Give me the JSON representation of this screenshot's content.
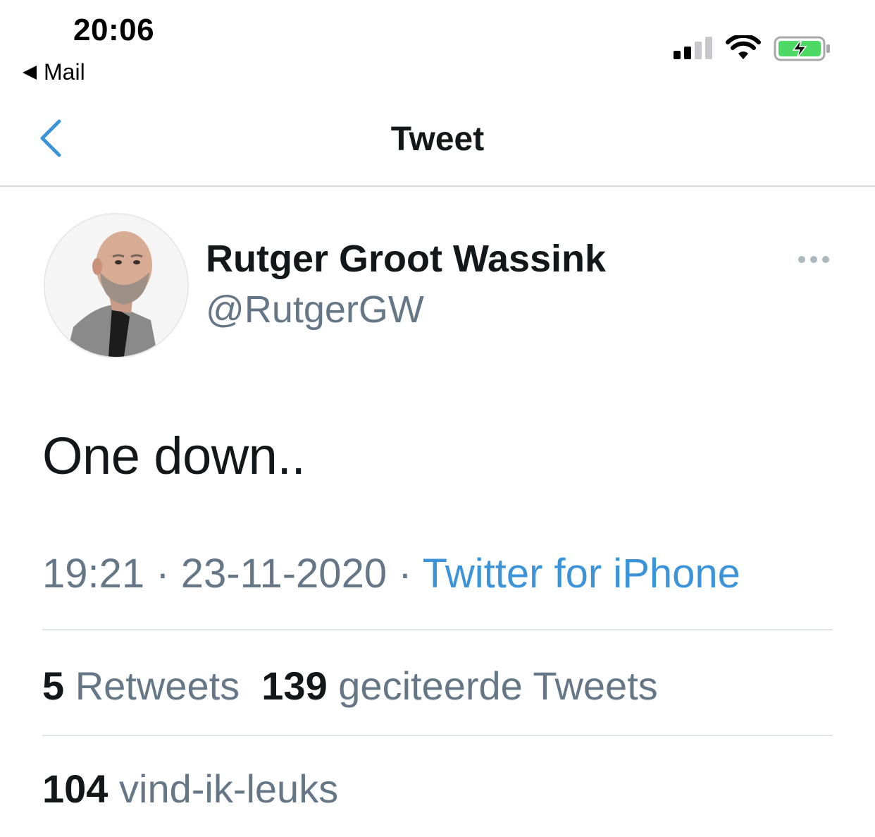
{
  "status_bar": {
    "time": "20:06",
    "back_app": "Mail",
    "icons": [
      "cellular-signal-icon",
      "wifi-icon",
      "battery-charging-icon"
    ],
    "battery_color": "#4cd964"
  },
  "nav": {
    "title": "Tweet",
    "back_icon": "chevron-left-icon",
    "accent_color": "#3b94d9"
  },
  "tweet": {
    "author": {
      "display_name": "Rutger Groot Wassink",
      "handle": "@RutgerGW"
    },
    "more_icon": "more-horizontal-icon",
    "text": "One down..",
    "time": "19:21",
    "separator": " · ",
    "date": "23-11-2020",
    "source": "Twitter for iPhone"
  },
  "stats": {
    "retweets_count": "5",
    "retweets_label": "Retweets",
    "quotes_count": "139",
    "quotes_label": "geciteerde Tweets",
    "likes_count": "104",
    "likes_label": "vind-ik-leuks"
  }
}
